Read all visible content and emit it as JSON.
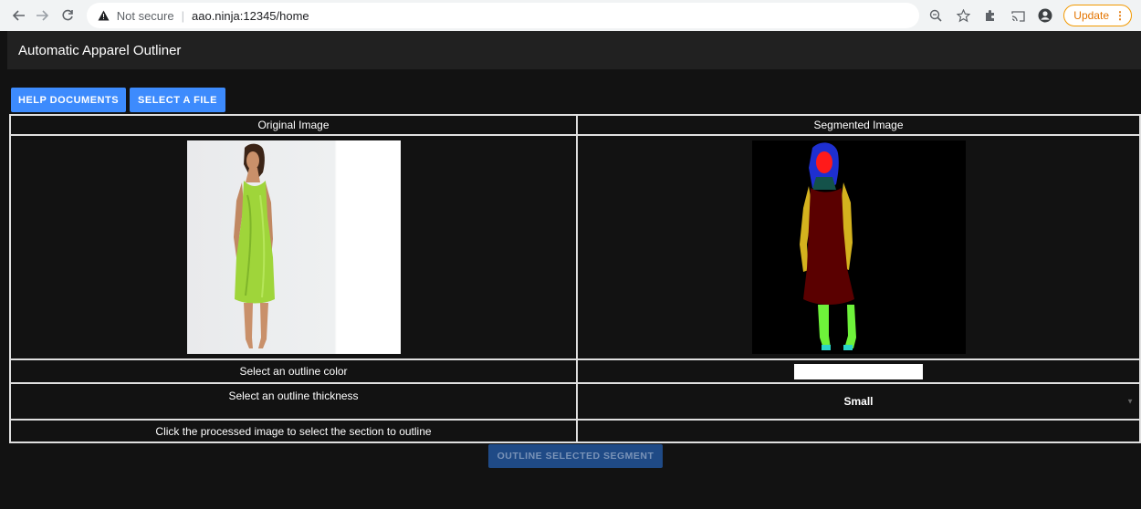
{
  "browser": {
    "security_label": "Not secure",
    "url": "aao.ninja:12345/home",
    "update_label": "Update"
  },
  "app": {
    "title": "Automatic Apparel Outliner"
  },
  "toolbar": {
    "help_label": "HELP DOCUMENTS",
    "file_label": "SELECT A FILE"
  },
  "table": {
    "original_header": "Original Image",
    "segmented_header": "Segmented Image",
    "color_label": "Select an outline color",
    "color_value": "#ffffff",
    "thickness_label": "Select an outline thickness",
    "thickness_value": "Small",
    "click_label": "Click the processed image to select the section to outline"
  },
  "actions": {
    "outline_label": "OUTLINE SELECTED SEGMENT"
  },
  "colors": {
    "accent": "#3d8bfd",
    "disabled_button": "#1f4a86",
    "header_bg": "#212121",
    "body_bg": "#121212",
    "segment_hair": "#1e2fd0",
    "segment_face": "#ff1a1a",
    "segment_dress": "#5a0000",
    "segment_arms": "#d4b21e",
    "segment_legs": "#6ef23a",
    "segment_neck": "#14524a",
    "dress_green": "#9fd53a"
  }
}
